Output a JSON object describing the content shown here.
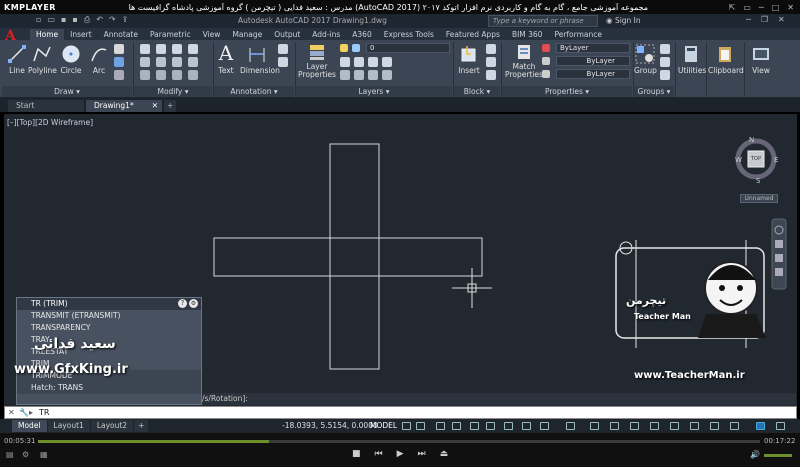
{
  "kmplayer": {
    "logo": "KMPLAYER",
    "title": "مجموعه آموزشی جامع ، گام به گام و کاربردی نرم افزار   اتوکد ۲۰۱۷ (AutoCAD 2017)   مدرس : سعید فدایی ( تیچرمن ) گروه آموزشی پادشاه گرافیست ها",
    "controls": [
      "⇱",
      "▭",
      "─",
      "□",
      "✕"
    ]
  },
  "acad_header": {
    "app_title": "Autodesk AutoCAD 2017    Drawing1.dwg",
    "search_placeholder": "Type a keyword or phrase",
    "sign_in": "Sign In"
  },
  "ribbon_tabs": [
    "Home",
    "Insert",
    "Annotate",
    "Parametric",
    "View",
    "Manage",
    "Output",
    "Add-ins",
    "A360",
    "Express Tools",
    "Featured Apps",
    "BIM 360",
    "Performance"
  ],
  "active_ribbon_tab": "Home",
  "ribbon": {
    "draw": {
      "line": "Line",
      "polyline": "Polyline",
      "circle": "Circle",
      "arc": "Arc",
      "title": "Draw"
    },
    "modify_title": "Modify",
    "annotation": {
      "text": "Text",
      "dimension": "Dimension",
      "title": "Annotation"
    },
    "layers": {
      "layer_properties": "Layer\nProperties",
      "layer_value": "0",
      "title": "Layers"
    },
    "block": {
      "insert": "Insert",
      "title": "Block"
    },
    "properties": {
      "match": "Match\nProperties",
      "bylayer_1": "ByLayer",
      "bylayer_2": "ByLayer",
      "bylayer_3": "ByLayer",
      "title": "Properties"
    },
    "groups": {
      "group": "Group",
      "title": "Groups"
    },
    "utilities": "Utilities",
    "clipboard": "Clipboard",
    "view": "View"
  },
  "doc_tabs": {
    "start": "Start",
    "drawing": "Drawing1*"
  },
  "viewport": {
    "label": "[–][Top][2D Wireframe]",
    "viewcube": {
      "n": "N",
      "s": "S",
      "e": "E",
      "w": "W",
      "top": "TOP",
      "wcs": "Unnamed"
    }
  },
  "command_palette": {
    "items": [
      "TR (TRIM)",
      "TRANSMIT (ETRANSMIT)",
      "TRANSPARENCY",
      "TRAY",
      "TREESTAT",
      "TRIM",
      "TRIMMODE",
      "Hatch: TRANS"
    ]
  },
  "command_history": "/s/Rotation]:",
  "command_input": "TR",
  "layout_tabs": [
    "Model",
    "Layout1",
    "Layout2"
  ],
  "status": {
    "coords": "-18.0393, 5.5154, 0.0000",
    "model": "MODEL"
  },
  "player": {
    "time_current": "00:05:31",
    "time_total": "00:17:22",
    "progress": 0.32
  },
  "watermarks": {
    "name_fa": "سعید فدائی",
    "gfxking": "www.GfxKing.ir",
    "teacherman_site": "www.TeacherMan.ir",
    "teacherman_fa": "تیچرمن",
    "teacherman_en": "Teacher Man"
  },
  "colors": {
    "accent_red": "#d42020",
    "progress": "#6c8f2a",
    "drawing_bg": "#212830"
  }
}
